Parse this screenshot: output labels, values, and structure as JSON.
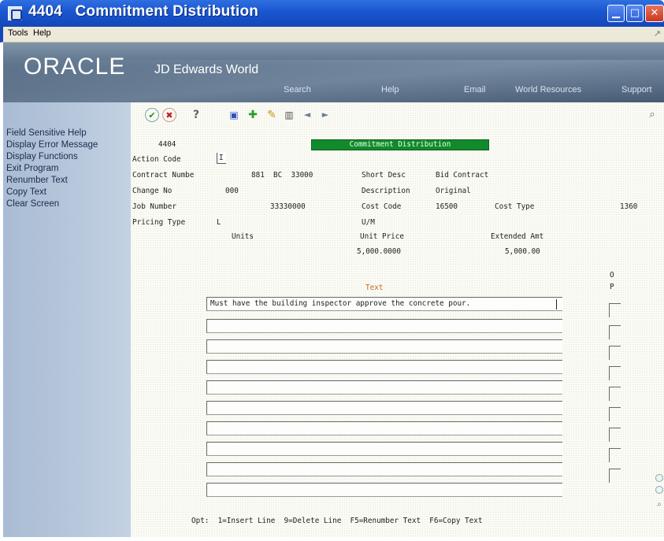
{
  "window": {
    "form_number": "4404",
    "title": "Commitment Distribution",
    "min_glyph": "▁",
    "max_glyph": "□",
    "close_glyph": "✕"
  },
  "menubar": {
    "tools": "Tools",
    "help": "Help",
    "right_icon": "↗"
  },
  "banner": {
    "oracle": "ORACLE",
    "jde": "JD Edwards World",
    "links": {
      "search": "Search",
      "help": "Help",
      "email": "Email",
      "world_resources": "World Resources",
      "support": "Support"
    }
  },
  "sidebar": {
    "items": [
      {
        "label": "Field Sensitive Help"
      },
      {
        "label": "Display Error Message"
      },
      {
        "label": "Display Functions"
      },
      {
        "label": "Exit Program"
      },
      {
        "label": "Renumber Text"
      },
      {
        "label": "Copy Text"
      },
      {
        "label": "Clear Screen"
      }
    ]
  },
  "toolbar": {
    "icons": {
      "ok": "✔",
      "cancel": "✖",
      "help": "?",
      "find": "▣",
      "add": "✚",
      "change": "✎",
      "delete": "▥",
      "prev": "◄",
      "next": "►",
      "zoom": "⌕"
    }
  },
  "form": {
    "form_id": "4404",
    "form_title": "Commitment Distribution",
    "action_code_label": "Action Code",
    "action_code_value": "I",
    "contract_number_label": "Contract Numbe",
    "contract_number_value": "881  BC  33000",
    "short_desc_label": "Short Desc",
    "short_desc_value": "Bid Contract",
    "change_no_label": "Change No",
    "change_no_value": "000",
    "description_label": "Description",
    "description_value": "Original",
    "job_number_label": "Job Number",
    "job_number_value": "33330000",
    "cost_code_label": "Cost Code",
    "cost_code_value": "16500",
    "cost_type_label": "Cost Type",
    "cost_type_value": "1360",
    "pricing_type_label": "Pricing Type",
    "pricing_type_value": "L",
    "um_label": "U/M",
    "units_label": "Units",
    "unit_price_label": "Unit Price",
    "unit_price_value": "5,000.0000",
    "extended_amt_label": "Extended Amt",
    "extended_amt_value": "5,000.00",
    "op_header_1": "O",
    "op_header_2": "P",
    "text_header": "Text",
    "text_lines": [
      "Must have the building inspector approve the concrete pour.",
      "",
      "",
      "",
      "",
      "",
      "",
      "",
      "",
      ""
    ],
    "footer": "Opt:  1=Insert Line  9=Delete Line  F5=Renumber Text  F6=Copy Text"
  }
}
